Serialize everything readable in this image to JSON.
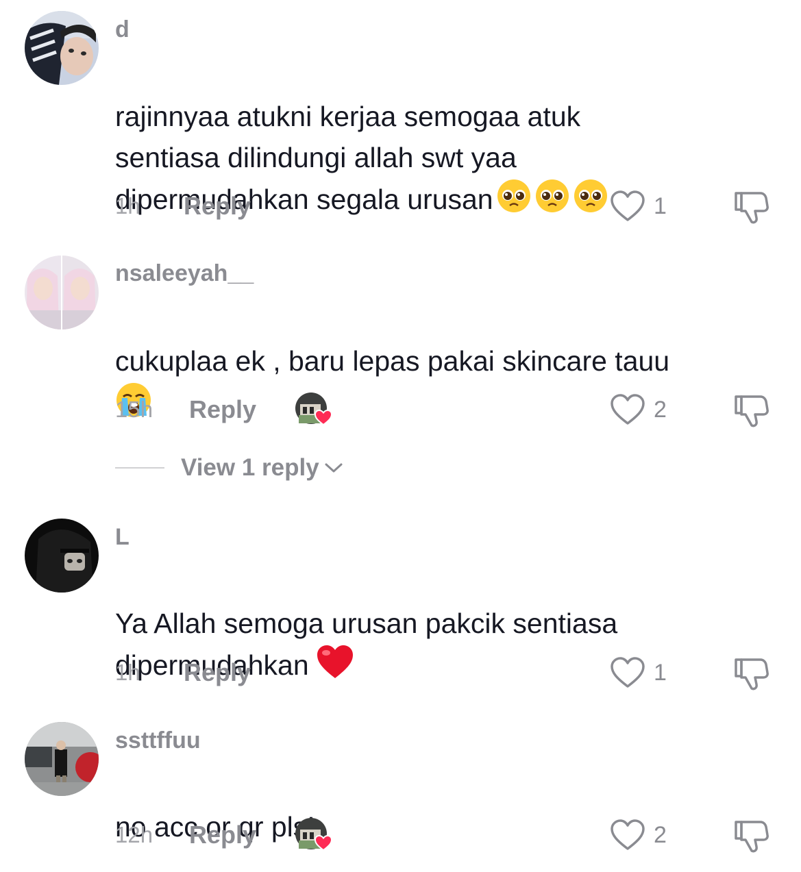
{
  "comments": [
    {
      "username": "d",
      "text": "rajinnyaa atukni kerjaa semogaa atuk\nsentiasa dilindungi allah swt yaa\ndipermudahkan segala urusan",
      "emojis": [
        "pleading-face",
        "pleading-face",
        "pleading-face"
      ],
      "time": "1h",
      "reply_label": "Reply",
      "likes": "1",
      "creator_liked": false
    },
    {
      "username": "nsaleeyah__",
      "text": "cukuplaa ek , baru lepas pakai skincare tauu",
      "emojis": [
        "loudly-crying-face"
      ],
      "time": "15h",
      "reply_label": "Reply",
      "likes": "2",
      "creator_liked": true,
      "view_replies_label": "View 1 reply"
    },
    {
      "username": "L",
      "text": "Ya Allah semoga urusan pakcik sentiasa\ndipermudahkan",
      "emojis": [
        "red-heart"
      ],
      "time": "1h",
      "reply_label": "Reply",
      "likes": "1",
      "creator_liked": false
    },
    {
      "username": "ssttffuu",
      "text": "no acc or qr pls!",
      "emojis": [],
      "time": "12h",
      "reply_label": "Reply",
      "likes": "2",
      "creator_liked": true
    }
  ],
  "colors": {
    "text": "#161823",
    "muted": "#8a8b91",
    "time": "#a4a5aa",
    "like_heart_badge": "#fe2c55"
  }
}
